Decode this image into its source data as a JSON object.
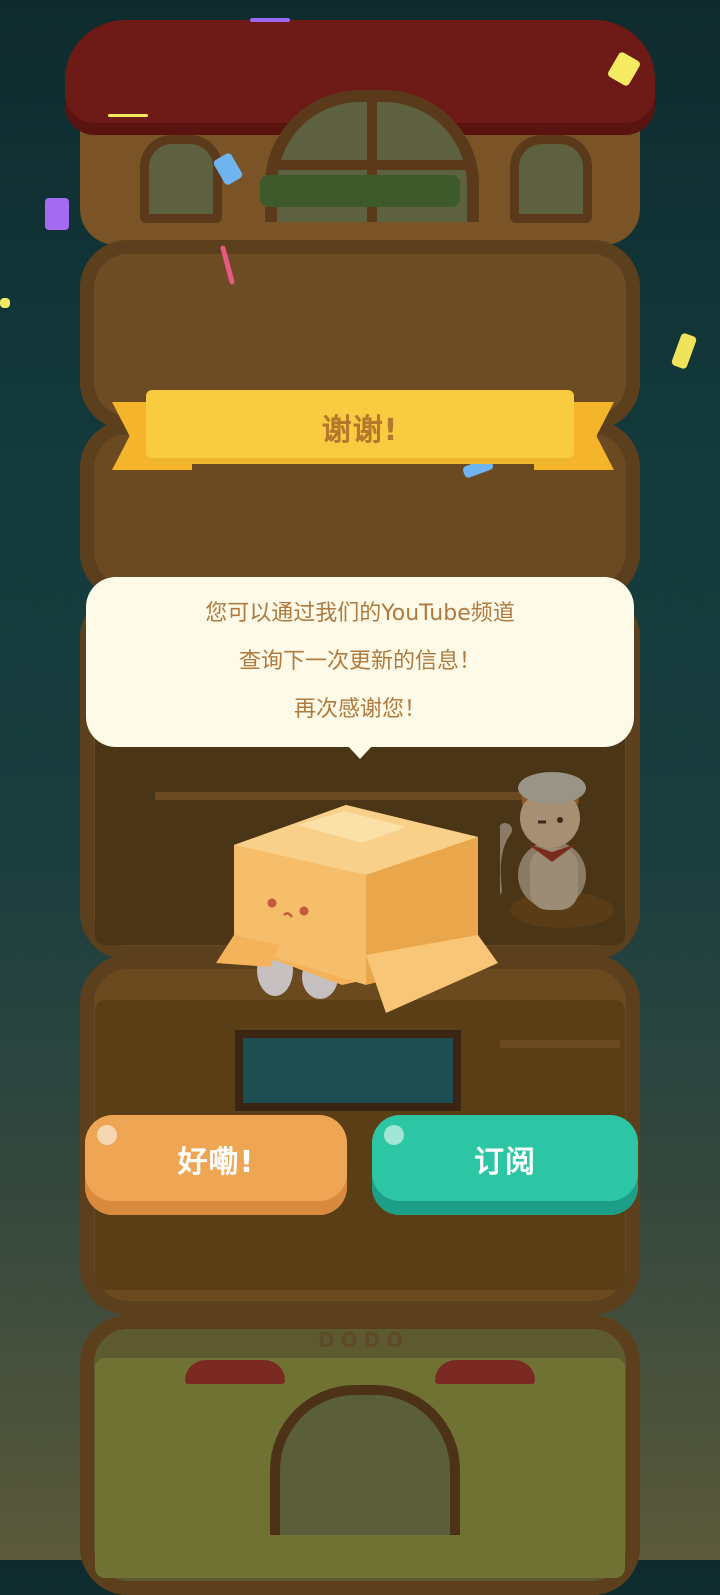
{
  "banner": {
    "title": "谢谢!"
  },
  "message": {
    "lines": [
      "您可以通过我们的YouTube频道",
      "查询下一次更新的信息！",
      "再次感谢您！"
    ]
  },
  "buttons": {
    "ok_label": "好嘞!",
    "subscribe_label": "订阅"
  },
  "house_sign": {
    "text": "DODO"
  },
  "colors": {
    "banner": "#f9cb40",
    "ok_button": "#eea655",
    "subscribe_button": "#2dc6a5",
    "bubble": "#fdfae8",
    "text_brown": "#b07a3e"
  }
}
